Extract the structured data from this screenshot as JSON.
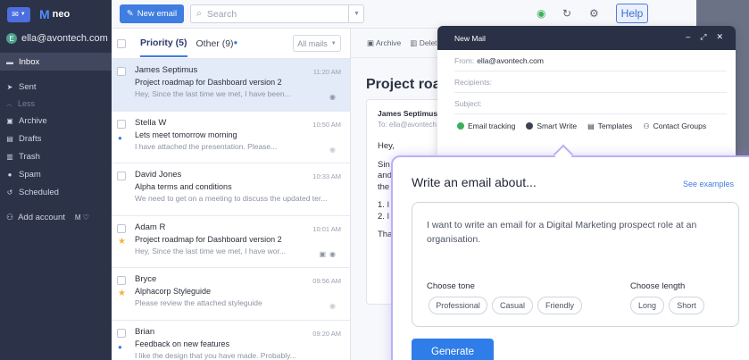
{
  "sidebar": {
    "logo": "neo",
    "account": "ella@avontech.com",
    "account_initial": "E",
    "items": [
      {
        "label": "Inbox",
        "icon": "inbox-icon"
      },
      {
        "label": "Sent",
        "icon": "send-icon"
      }
    ],
    "less_label": "Less",
    "folders": [
      {
        "label": "Archive",
        "icon": "archive-icon"
      },
      {
        "label": "Drafts",
        "icon": "draft-icon"
      },
      {
        "label": "Trash",
        "icon": "trash-icon"
      },
      {
        "label": "Spam",
        "icon": "spam-icon"
      },
      {
        "label": "Scheduled",
        "icon": "clock-icon"
      }
    ],
    "add_account": "Add account"
  },
  "topbar": {
    "new_email": "New email",
    "search_placeholder": "Search",
    "help": "Help"
  },
  "list": {
    "tab_priority": "Priority (5)",
    "tab_other": "Other (9)",
    "filter": "All mails",
    "mails": [
      {
        "sender": "James Septimus",
        "subject": "Project roadmap for Dashboard version 2",
        "preview": "Hey, Since the last time we met, I have been...",
        "time": "11:20 AM"
      },
      {
        "sender": "Stella W",
        "subject": "Lets meet tomorrow morning",
        "preview": "I have attached the presentation. Please...",
        "time": "10:50 AM"
      },
      {
        "sender": "David Jones",
        "subject": "Alpha terms and conditions",
        "preview": "We need to get on a meeting to discuss the updated ter...",
        "time": "10:33 AM"
      },
      {
        "sender": "Adam R",
        "subject": "Project roadmap for Dashboard version 2",
        "preview": "Hey, Since the last time we met, I have wor...",
        "time": "10:01 AM"
      },
      {
        "sender": "Bryce",
        "subject": "Alphacorp Styleguide",
        "preview": "Please review the attached styleguide",
        "time": "09:56 AM"
      },
      {
        "sender": "Brian",
        "subject": "Feedback on new features",
        "preview": "I like the design that you have made. Probably...",
        "time": "09:20 AM"
      }
    ]
  },
  "reading": {
    "archive": "Archive",
    "delete": "Delet",
    "title": "Project road",
    "from": "James Septimus",
    "to": "To: ella@avontech",
    "body_lines": [
      "Hey,",
      "Sin",
      "and",
      "the",
      "1. I",
      "2. I",
      "Tha"
    ]
  },
  "newmail": {
    "title": "New Mail",
    "from_label": "From:",
    "from_value": "ella@avontech.com",
    "recipients": "Recipients:",
    "subject": "Subject:",
    "tools": [
      "Email tracking",
      "Smart Write",
      "Templates",
      "Contact Groups"
    ]
  },
  "smartwrite": {
    "title": "Write an email about...",
    "see_examples": "See examples",
    "prompt": "I want to write an email for a Digital Marketing prospect role at an organisation.",
    "tone_label": "Choose tone",
    "tones": [
      "Professional",
      "Casual",
      "Friendly"
    ],
    "length_label": "Choose length",
    "lengths": [
      "Long",
      "Short"
    ],
    "generate": "Generate"
  }
}
